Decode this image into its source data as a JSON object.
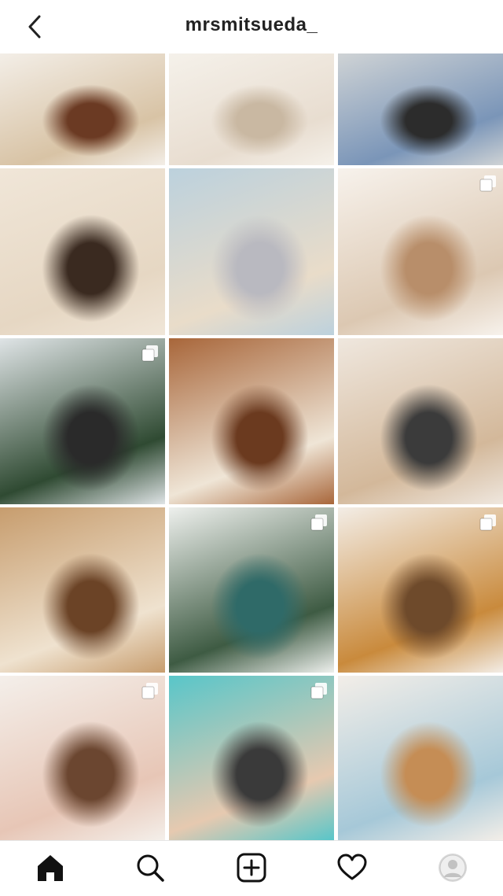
{
  "header": {
    "username": "mrsmitsueda_",
    "back_icon": "chevron-left-icon"
  },
  "grid": {
    "posts": [
      {
        "name": "post-mirror-bump",
        "multi": false,
        "colors": [
          "#f3eee7",
          "#d8c3a5",
          "#6b3a23"
        ]
      },
      {
        "name": "post-bed-pillow",
        "multi": false,
        "colors": [
          "#f5f1ea",
          "#e8ddd0",
          "#c9b8a2"
        ]
      },
      {
        "name": "post-car-seat",
        "multi": false,
        "colors": [
          "#cfd3d5",
          "#7a95b8",
          "#2c2c2c"
        ]
      },
      {
        "name": "post-bedroom-pose",
        "multi": false,
        "colors": [
          "#f0e6d8",
          "#e6d7c3",
          "#3a2a20"
        ]
      },
      {
        "name": "post-beach-sitting",
        "multi": false,
        "colors": [
          "#bcd1dd",
          "#e9dcc9",
          "#b9b9c0"
        ]
      },
      {
        "name": "post-nursery-closet",
        "multi": true,
        "colors": [
          "#f7f2ec",
          "#dcc8b2",
          "#b88e6a"
        ]
      },
      {
        "name": "post-family-snow",
        "multi": true,
        "colors": [
          "#dfe4e6",
          "#2f4a32",
          "#2a2a2a"
        ]
      },
      {
        "name": "post-little-brother",
        "multi": false,
        "colors": [
          "#a8663a",
          "#efe5d6",
          "#6b3a1f"
        ]
      },
      {
        "name": "post-mirror-selfie",
        "multi": false,
        "colors": [
          "#efe7de",
          "#d3b89a",
          "#3b3b3b"
        ]
      },
      {
        "name": "post-living-room-tree",
        "multi": false,
        "colors": [
          "#c79d6e",
          "#efe2cf",
          "#6b4326"
        ]
      },
      {
        "name": "post-kids-christmas",
        "multi": true,
        "colors": [
          "#eef0ed",
          "#3e5b43",
          "#2f6a68"
        ]
      },
      {
        "name": "post-gift-box",
        "multi": true,
        "colors": [
          "#f3ede6",
          "#c98a3c",
          "#6e4a2b"
        ]
      },
      {
        "name": "post-toddler-baby",
        "multi": true,
        "colors": [
          "#f4efea",
          "#e7c6b6",
          "#6b4630"
        ]
      },
      {
        "name": "post-couple-car",
        "multi": true,
        "colors": [
          "#58c6c9",
          "#e6c9b0",
          "#3a3a3a"
        ]
      },
      {
        "name": "post-baby-shower",
        "multi": false,
        "colors": [
          "#f3eee8",
          "#a6c8d8",
          "#c58d55"
        ]
      }
    ]
  },
  "tabbar": {
    "items": [
      {
        "name": "tab-home",
        "icon": "home-icon"
      },
      {
        "name": "tab-search",
        "icon": "search-icon"
      },
      {
        "name": "tab-create",
        "icon": "plus-square-icon"
      },
      {
        "name": "tab-activity",
        "icon": "heart-icon"
      },
      {
        "name": "tab-profile",
        "icon": "avatar-icon"
      }
    ]
  }
}
